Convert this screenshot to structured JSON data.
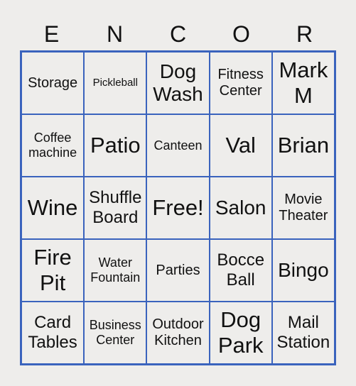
{
  "header": {
    "letters": [
      "E",
      "N",
      "C",
      "O",
      "R"
    ]
  },
  "grid": {
    "cells": [
      [
        "Storage",
        "Pickleball",
        "Dog Wash",
        "Fitness Center",
        "Mark M"
      ],
      [
        "Coffee machine",
        "Patio",
        "Canteen",
        "Val",
        "Brian"
      ],
      [
        "Wine",
        "Shuffle Board",
        "Free!",
        "Salon",
        "Movie Theater"
      ],
      [
        "Fire Pit",
        "Water Fountain",
        "Parties",
        "Bocce Ball",
        "Bingo"
      ],
      [
        "Card Tables",
        "Business Center",
        "Outdoor Kitchen",
        "Dog Park",
        "Mail Station"
      ]
    ]
  },
  "colors": {
    "grid_line": "#3a63bd",
    "background": "#eeedeb",
    "text": "#111111"
  }
}
